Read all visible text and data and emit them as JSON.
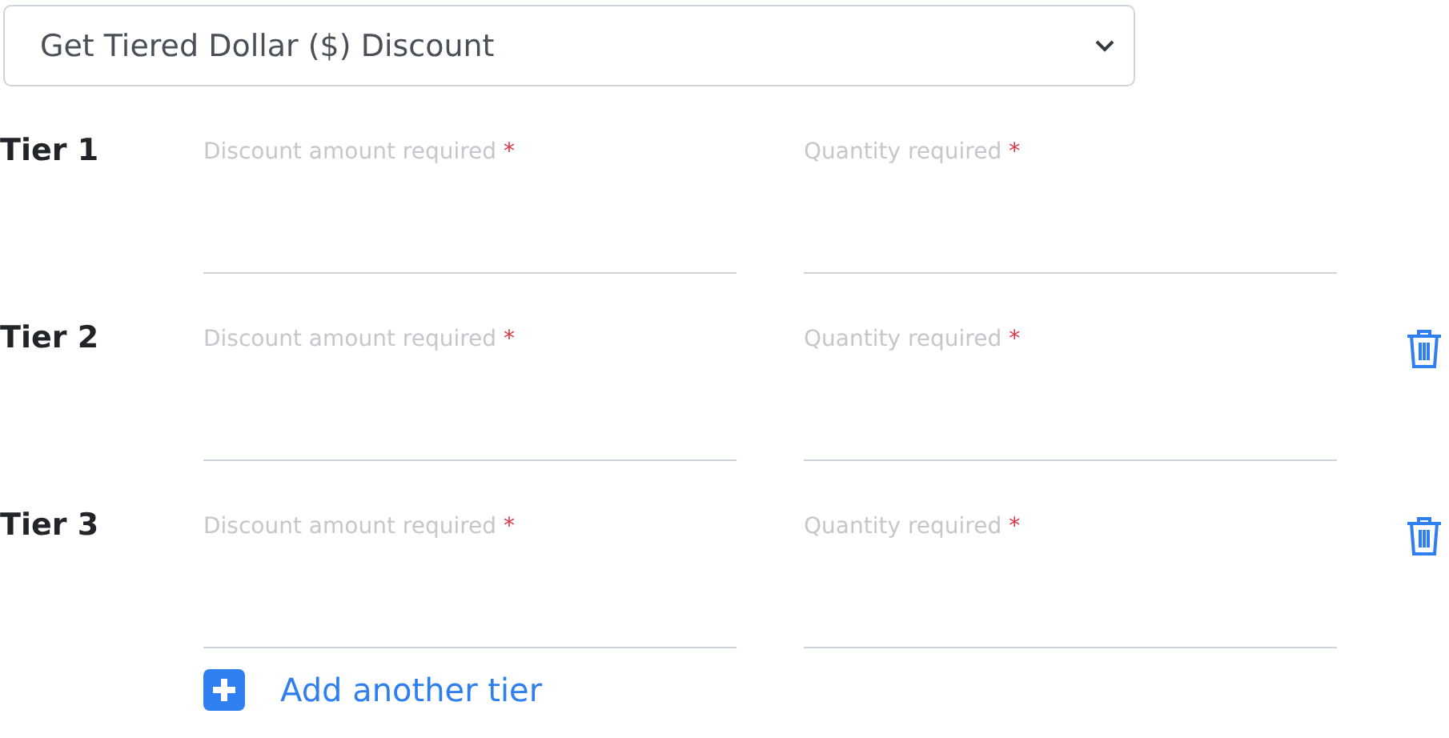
{
  "discount_type": {
    "value": "Get Tiered Dollar ($) Discount"
  },
  "tiers": [
    {
      "label": "Tier 1",
      "removable": false,
      "fields": [
        {
          "placeholder": "Discount amount required",
          "required_mark": "*"
        },
        {
          "placeholder": "Quantity required",
          "required_mark": "*"
        }
      ]
    },
    {
      "label": "Tier 2",
      "removable": true,
      "fields": [
        {
          "placeholder": "Discount amount required",
          "required_mark": "*"
        },
        {
          "placeholder": "Quantity required",
          "required_mark": "*"
        }
      ]
    },
    {
      "label": "Tier 3",
      "removable": true,
      "fields": [
        {
          "placeholder": "Discount amount required",
          "required_mark": "*"
        },
        {
          "placeholder": "Quantity required",
          "required_mark": "*"
        }
      ]
    }
  ],
  "add_tier": {
    "label": "Add another tier"
  }
}
